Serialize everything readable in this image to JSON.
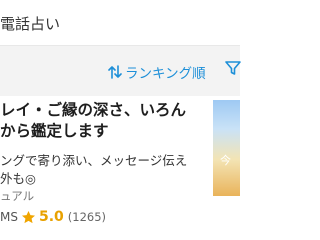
{
  "header": {
    "title": "電話占い"
  },
  "sortbar": {
    "sort_label": "ランキング順"
  },
  "card": {
    "title_lines": [
      "レイ・ご縁の深さ、いろん",
      "から鑑定します"
    ],
    "description_lines": [
      "ングで寄り添い、メッセージ伝え",
      "外も◎"
    ],
    "tag": "ュアル",
    "rating_prefix": "MS",
    "rating": "5.0",
    "review_count": "(1265)",
    "thumbnail_label": "今"
  },
  "colors": {
    "accent": "#1d8fd8",
    "star": "#f0a500",
    "sortbar_bg": "#f3f3f3"
  },
  "icons": {
    "sort": "sort-arrows-icon",
    "filter": "filter-icon",
    "rating": "star-icon"
  }
}
